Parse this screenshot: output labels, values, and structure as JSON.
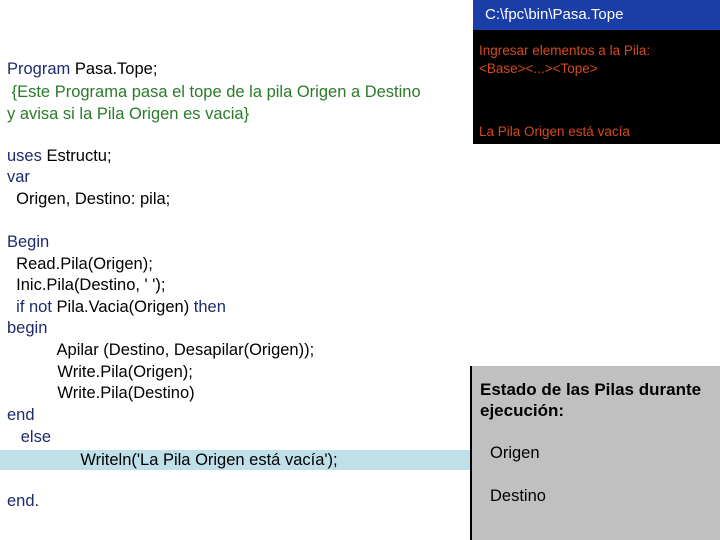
{
  "console": {
    "title": "C:\\fpc\\bin\\Pasa.Tope",
    "line1": "Ingresar elementos a la Pila:",
    "line2": "<Base><...><Tope>",
    "line3": "La Pila Origen está vacía"
  },
  "code": {
    "l1_kw": "Program",
    "l1_rest": " Pasa.Tope;",
    "l2": " {Este Programa pasa el tope de la pila Origen a Destino",
    "l3": "y avisa si la Pila Origen es vacia}",
    "l4_kw": "uses",
    "l4_rest": " Estructu;",
    "l5": "var",
    "l6": "  Origen, Destino: pila;",
    "l7": "Begin",
    "l8": "  Read.Pila(Origen);",
    "l9": "  Inic.Pila(Destino, ' ');",
    "l10_a": "  if",
    "l10_b": " not",
    "l10_c": " Pila.Vacia(Origen) ",
    "l10_d": "then",
    "l11": "begin",
    "l12": "           Apilar (Destino, Desapilar(Origen));",
    "l13": "           Write.Pila(Origen);",
    "l14": "           Write.Pila(Destino)",
    "l15": "end",
    "l16": "   else",
    "l17": "                Writeln('La Pila Origen está vacía');",
    "l18": "end."
  },
  "state_panel": {
    "title_line1": "Estado de las Pilas durante",
    "title_line2": "ejecución:",
    "origen": "Origen",
    "destino": "Destino"
  },
  "colors": {
    "console_title_bg": "#1a3ea8",
    "console_text": "#d44a1e",
    "highlight": "#bfe0e8",
    "comment": "#2a7a2a",
    "keyword": "#1f2a6e"
  }
}
